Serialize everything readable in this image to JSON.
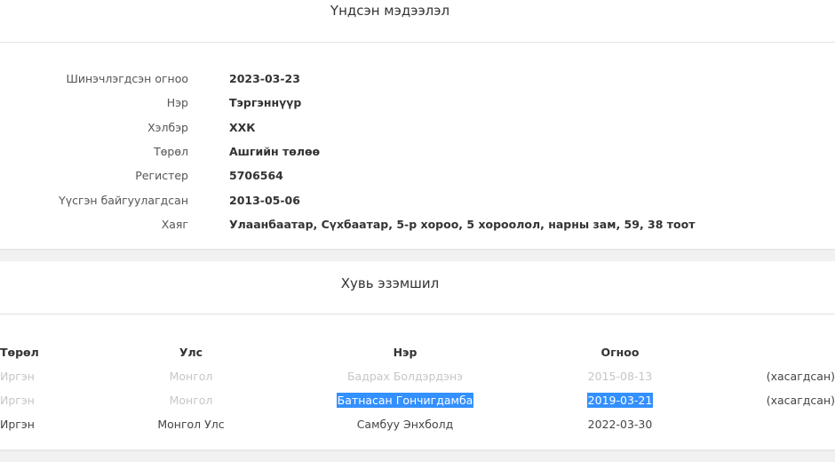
{
  "basic_info": {
    "title": "Үндсэн мэдээлэл",
    "rows": [
      {
        "label": "Шинэчлэгдсэн огноо",
        "value": "2023-03-23"
      },
      {
        "label": "Нэр",
        "value": "Тэргэннүүр"
      },
      {
        "label": "Хэлбэр",
        "value": "ХХК"
      },
      {
        "label": "Төрөл",
        "value": "Ашгийн төлөө"
      },
      {
        "label": "Регистер",
        "value": "5706564"
      },
      {
        "label": "Үүсгэн байгуулагдсан",
        "value": "2013-05-06"
      },
      {
        "label": "Хаяг",
        "value": "Улаанбаатар, Сүхбаатар, 5-р хороо, 5 хороолол, нарны зам, 59, 38 тоот"
      }
    ]
  },
  "ownership": {
    "title": "Хувь эзэмшил",
    "columns": {
      "type": "Төрөл",
      "country": "Улс",
      "name": "Нэр",
      "date": "Огноо"
    },
    "rows": [
      {
        "type": "Иргэн",
        "country": "Монгол",
        "name": "Бадрах Болдэрдэнэ",
        "date": "2015-08-13",
        "status": "(хасагдсан)"
      },
      {
        "type": "Иргэн",
        "country": "Монгол",
        "name": "Батнасан Гончигдамба",
        "date": "2019-03-21",
        "status": "(хасагдсан)"
      },
      {
        "type": "Иргэн",
        "country": "Монгол Улс",
        "name": "Самбуу Энхболд",
        "date": "2022-03-30",
        "status": ""
      }
    ]
  },
  "colors": {
    "removed_status": "#c9302c",
    "selection": "#3390ff",
    "muted_text": "#c6c6c6"
  }
}
